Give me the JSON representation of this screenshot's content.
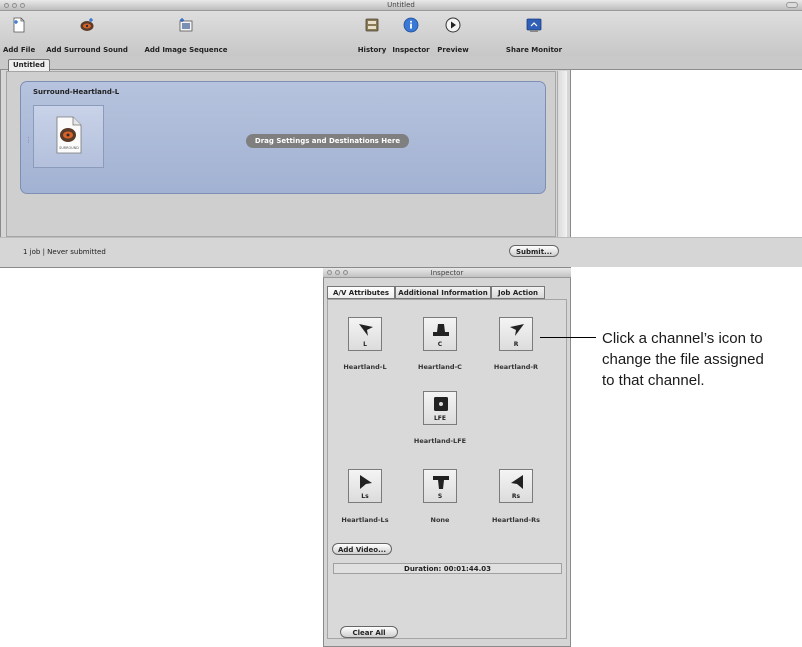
{
  "main_window": {
    "title": "Untitled",
    "toolbar": {
      "add_file": "Add File",
      "add_surround_sound": "Add Surround Sound",
      "add_image_sequence": "Add Image Sequence",
      "history": "History",
      "inspector": "Inspector",
      "preview": "Preview",
      "share_monitor": "Share Monitor"
    },
    "tab": "Untitled",
    "job": {
      "name": "Surround-Heartland-L",
      "thumbnail_label": "SURROUND",
      "drop_hint": "Drag Settings and Destinations Here"
    },
    "status": {
      "text": "1 job  |  Never submitted",
      "submit": "Submit..."
    }
  },
  "inspector": {
    "title": "Inspector",
    "tabs": [
      "A/V Attributes",
      "Additional Information",
      "Job Action"
    ],
    "active_tab": "A/V Attributes",
    "channels": {
      "L": {
        "label": "L",
        "file": "Heartland-L"
      },
      "C": {
        "label": "C",
        "file": "Heartland-C"
      },
      "R": {
        "label": "R",
        "file": "Heartland-R"
      },
      "LFE": {
        "label": "LFE",
        "file": "Heartland-LFE"
      },
      "Ls": {
        "label": "Ls",
        "file": "Heartland-Ls"
      },
      "S": {
        "label": "S",
        "file": "None"
      },
      "Rs": {
        "label": "Rs",
        "file": "Heartland-Rs"
      }
    },
    "add_video": "Add Video...",
    "duration": "Duration: 00:01:44.03",
    "clear_all": "Clear All"
  },
  "callout": {
    "line1": "Click a channel’s icon to",
    "line2": "change the file assigned",
    "line3": "to that channel."
  },
  "colors": {
    "job_fill": "#a9b8d6",
    "window_bg": "#d6d6d6",
    "pill_gray": "#7f7f7f"
  }
}
